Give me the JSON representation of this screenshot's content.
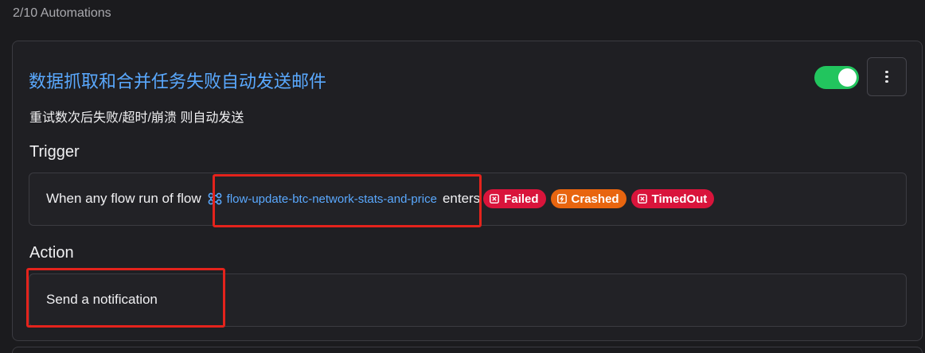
{
  "header": {
    "automation_count": "2/10 Automations"
  },
  "automation": {
    "title": "数据抓取和合并任务失败自动发送邮件",
    "description": "重试数次后失败/超时/崩溃 则自动发送",
    "enabled": true,
    "menu_icon": "vertical-dots-icon"
  },
  "trigger": {
    "heading": "Trigger",
    "prefix": "When any flow run of flow",
    "flow_name": "flow-update-btc-network-stats-and-price",
    "flow_icon": "flow-icon",
    "suffix": "enters",
    "states": [
      {
        "label": "Failed",
        "color": "#d9143b",
        "icon": "failed-state-icon"
      },
      {
        "label": "Crashed",
        "color": "#e8650f",
        "icon": "crashed-state-icon"
      },
      {
        "label": "TimedOut",
        "color": "#d9143b",
        "icon": "timedout-state-icon"
      }
    ]
  },
  "action": {
    "heading": "Action",
    "text": "Send a notification"
  },
  "colors": {
    "accent": "#5aa9ff",
    "toggle_on": "#22c55e",
    "highlight": "#e4231c"
  }
}
